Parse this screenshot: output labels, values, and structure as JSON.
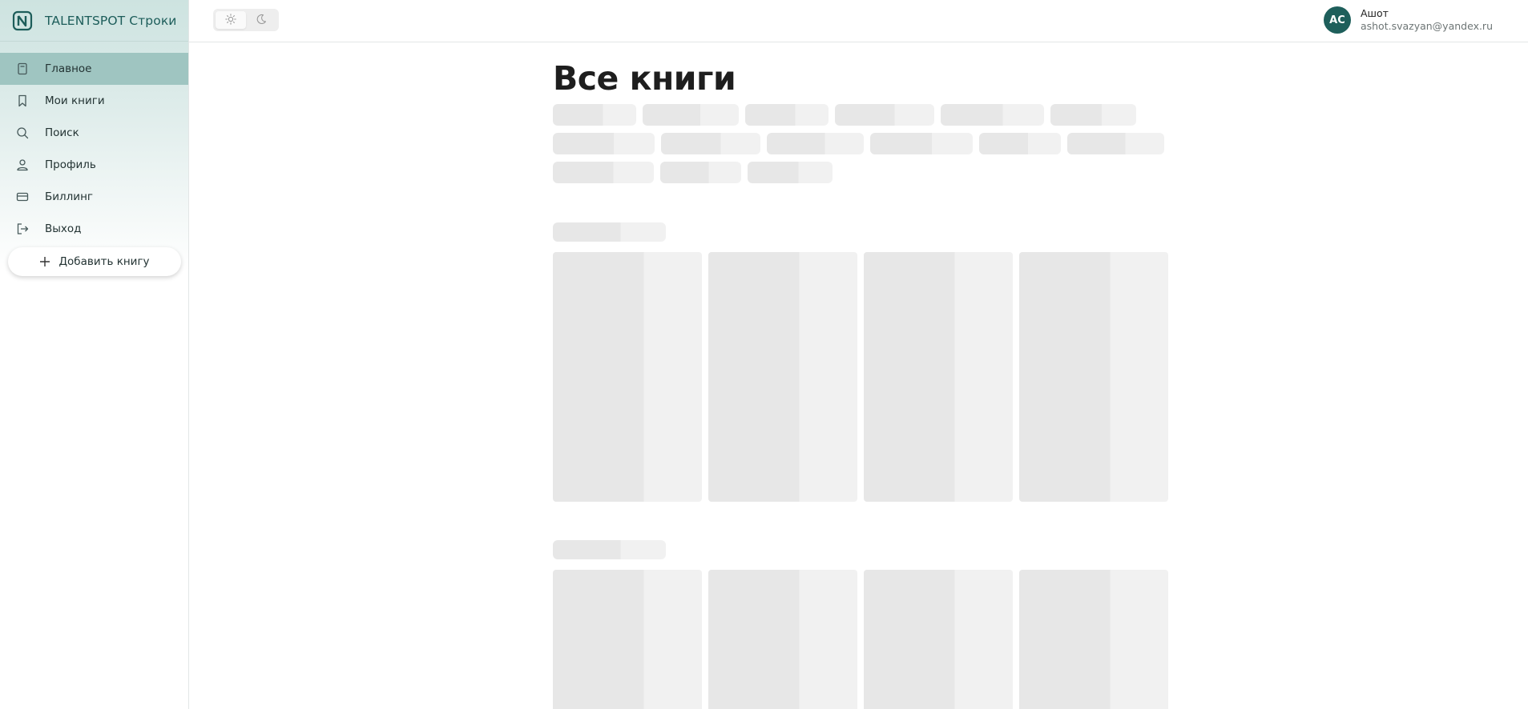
{
  "brand": {
    "name": "TALENTSPOT Строки",
    "logo_icon": "book-logo-icon",
    "color": "#1d5d5a"
  },
  "sidebar": {
    "items": [
      {
        "label": "Главное",
        "icon": "book-icon",
        "active": true
      },
      {
        "label": "Мои книги",
        "icon": "bookmark-icon",
        "active": false
      },
      {
        "label": "Поиск",
        "icon": "search-icon",
        "active": false
      },
      {
        "label": "Профиль",
        "icon": "user-icon",
        "active": false
      },
      {
        "label": "Биллинг",
        "icon": "credit-card-icon",
        "active": false
      },
      {
        "label": "Выход",
        "icon": "logout-icon",
        "active": false
      }
    ],
    "add_button": "Добавить книгу"
  },
  "topbar": {
    "theme": {
      "light_icon": "sun-icon",
      "dark_icon": "moon-icon",
      "selected": "light"
    },
    "user": {
      "initials": "АС",
      "name": "Ашот",
      "email": "ashot.svazyan@yandex.ru"
    }
  },
  "main": {
    "title": "Все книги"
  },
  "colors": {
    "accent": "#1e5f5b",
    "active_nav": "#9fc5c1",
    "skeleton_dark": "#e7e7e7",
    "skeleton_light": "#f1f1f1"
  }
}
